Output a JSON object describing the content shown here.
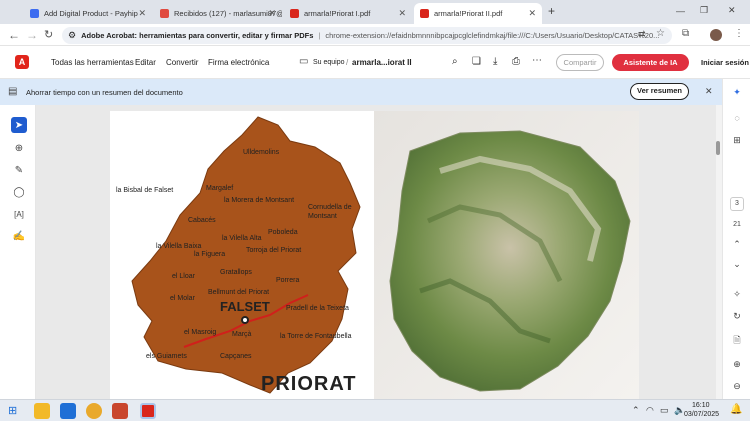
{
  "browser": {
    "tabs": [
      {
        "label": "Add Digital Product - Payhip",
        "color": "#3d6cf0",
        "active": false
      },
      {
        "label": "Recibidos (127) - marlasumi87@",
        "color": "#e04a3f",
        "active": false
      },
      {
        "label": "armarla!Priorat I.pdf",
        "color": "#d9261c",
        "active": false
      },
      {
        "label": "armarla!Priorat II.pdf",
        "color": "#d9261c",
        "active": true
      }
    ],
    "new_tab": "+",
    "url_site": "Adobe Acrobat: herramientas para convertir, editar y firmar PDFs",
    "url": "chrome-extension://efaidnbmnnnibpcajpcglclefindmkaj/file:///C:/Users/Usuario/Desktop/CATAS%20..."
  },
  "acrobat": {
    "menu": [
      "Todas las herramientas",
      "Editar",
      "Convertir",
      "Firma electrónica"
    ],
    "breadcrumb_root": "Su equipo",
    "breadcrumb_sep": "/",
    "file_name": "armarla...iorat II",
    "share_label": "Compartir",
    "ai_label": "Asistente de IA",
    "signin_label": "Iniciar sesión",
    "banner_text": "Ahorrar tiempo con un resumen del documento",
    "banner_button": "Ver resumen",
    "page_number": "3",
    "page_total": "21"
  },
  "map": {
    "region_title": "PRIORAT",
    "capital": "FALSET",
    "towns": [
      "Ulldemolins",
      "la Bisbal de Falset",
      "Margalef",
      "la Morera de Montsant",
      "Cornudella de Montsant",
      "Cabacés",
      "Poboleda",
      "la Vilella Alta",
      "la Vilella Baixa",
      "Torroja del Priorat",
      "la Figuera",
      "el Lloar",
      "Gratallops",
      "Porrera",
      "Bellmunt del Priorat",
      "el Molar",
      "Pradell de la Teixeta",
      "el Masroig",
      "Marçà",
      "la Torre de Fontaubella",
      "els Guiamets",
      "Capçanes"
    ],
    "fill_color": "#a8531b",
    "road_color": "#d0201b"
  },
  "taskbar": {
    "time": "16:10",
    "date": "03/07/2025"
  }
}
